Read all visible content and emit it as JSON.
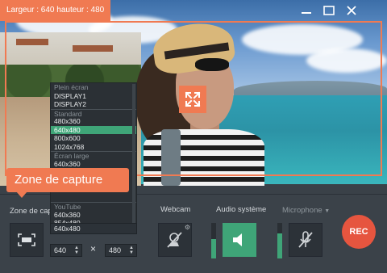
{
  "capture": {
    "size_label": "Largeur : 640 hauteur : 480",
    "tooltip": "Zone de capture"
  },
  "window_icons": [
    "minimize-icon",
    "fullscreen-icon",
    "close-icon"
  ],
  "panel": {
    "capture_area_label": "Zone de cap",
    "webcam_label": "Webcam",
    "system_audio_label": "Audio système",
    "microphone_label": "Microphone",
    "width_value": "640",
    "height_value": "480",
    "times_sign": "×",
    "rec_label": "REC",
    "system_audio_level": 0.55,
    "microphone_level": 0.7
  },
  "dropdown": {
    "items": [
      {
        "label": "Plein écran",
        "kind": "group"
      },
      {
        "label": "DISPLAY1",
        "kind": "item"
      },
      {
        "label": "DISPLAY2",
        "kind": "item"
      },
      {
        "label": "Standard",
        "kind": "group"
      },
      {
        "label": "480x360",
        "kind": "item"
      },
      {
        "label": "640x480",
        "kind": "selected"
      },
      {
        "label": "800x600",
        "kind": "item"
      },
      {
        "label": "1024x768",
        "kind": "item"
      },
      {
        "label": "Écran large",
        "kind": "group"
      },
      {
        "label": "640x360",
        "kind": "item"
      },
      {
        "label": "",
        "kind": "item"
      },
      {
        "label": "",
        "kind": "item"
      },
      {
        "label": "",
        "kind": "item"
      },
      {
        "label": "",
        "kind": "item"
      },
      {
        "label": "YouTube",
        "kind": "group"
      },
      {
        "label": "640x360",
        "kind": "item"
      },
      {
        "label": "854x480",
        "kind": "item"
      }
    ],
    "current": "640x480"
  },
  "colors": {
    "accent": "#f07a52",
    "green": "#3fa578",
    "rec": "#e6553f"
  }
}
